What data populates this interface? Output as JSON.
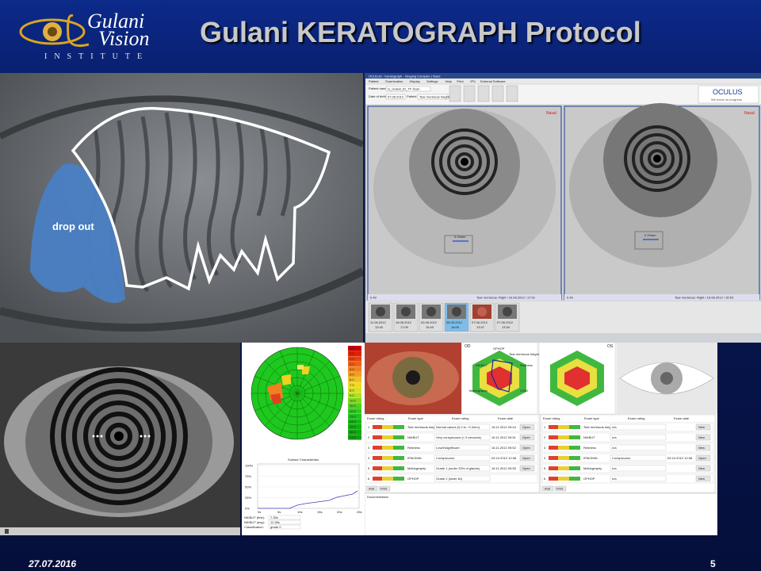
{
  "slide": {
    "title": "Gulani KERATOGRAPH Protocol",
    "date": "27.07.2016",
    "page_number": "5"
  },
  "logo": {
    "name_line1": "Gulani",
    "name_line2": "Vision",
    "institute": "INSTITUTE"
  },
  "tear_film": {
    "dropout_label": "drop out"
  },
  "app": {
    "title": "OCULUS - Keratograph - Imaging Compare | Tears",
    "menu": [
      "Patient",
      "Examination",
      "Display",
      "Settings",
      "Help",
      "Print",
      "IPX",
      "External Software"
    ],
    "patient_name_label": "Patient name:",
    "patient_name": "G_Gulani_ID_TF Scan",
    "dob_label": "Date of birth:",
    "dob": "07.08.2012",
    "patient_id_label": "Patient ID:",
    "patient_id": "Tear meniscus height",
    "brand": "OCULUS",
    "brand_tagline": "We focus on progress",
    "left_eye_label": "Nasal",
    "right_eye_label": "Nasal",
    "left_caption": "Tear meniscus: Right / 16.08.2012 / 17:01",
    "right_caption": "Tear meniscus: Right / 16.08.2012 / 16:53",
    "left_value": "0.49",
    "right_value": "0.49",
    "meniscus_left": "0.19mm",
    "meniscus_right": "0.19mm",
    "thumbnails": [
      {
        "date": "11.06.2012",
        "time": "13:40"
      },
      {
        "date": "16.06.2012",
        "time": "17:00"
      },
      {
        "date": "02.06.2012",
        "time": "15:40"
      },
      {
        "date": "08.05.2012",
        "time": "16:06"
      },
      {
        "date": "07.06.2012",
        "time": "13:37"
      },
      {
        "date": "07.06.2012",
        "time": "13:34"
      }
    ]
  },
  "heatmap": {
    "scale": [
      "0.0",
      "1.0",
      "2.0",
      "3.0",
      "4.0",
      "5.0",
      "6.0",
      "7.0",
      "8.0",
      "9.0",
      "10.0",
      "11.0",
      "12.0",
      "13.0",
      "14.0",
      "15.0",
      "16.0",
      "17.0"
    ]
  },
  "graph": {
    "title": "Surface Characteristic",
    "xlabels": [
      "0s",
      "5s",
      "10s",
      "15s",
      "20s",
      "25s"
    ],
    "ylabels": [
      "100%",
      "75%",
      "50%",
      "25%",
      "0%"
    ],
    "fields": [
      {
        "label": "NIKBUT (first):",
        "value": "7.39s"
      },
      {
        "label": "NIKBUT (avg):",
        "value": "11.38s"
      },
      {
        "label": "Classification:",
        "value": "grade 0"
      }
    ]
  },
  "report": {
    "od_label": "OD",
    "os_label": "OS",
    "radar_axes": [
      "OPHOP",
      "Tear meniscus height",
      "NIKBUT",
      "Redness",
      "Meibography",
      "OSDI"
    ],
    "table_headers": [
      "Exam rating",
      "Exam type",
      "Exam rating",
      "Exam date"
    ],
    "od_rows": [
      {
        "type": "Tear meniscus height",
        "rating": "Normal values (0.2 to ~0.3mm)",
        "date": "16.11.2012 09:44",
        "button": "Open"
      },
      {
        "type": "NIKBUT",
        "rating": "Very conspicuous (< 5 seconds)",
        "date": "16.11.2012 09:51",
        "button": "Open"
      },
      {
        "type": "Redness",
        "rating": "Low/Insignificant",
        "date": "16.11.2012 09:52",
        "button": "Open"
      },
      {
        "type": "IPM/JMIN",
        "rating": "Conspicuous",
        "date": "09.10.2012 10:38",
        "button": "Open"
      },
      {
        "type": "Meibography",
        "rating": "Grade 1 (under 33% of glands)",
        "date": "16.11.2012 09:55",
        "button": "Open"
      },
      {
        "type": "OPHOP",
        "rating": "Grade 2 (lower lid)",
        "date": "",
        "button": ""
      }
    ],
    "os_rows": [
      {
        "type": "Tear meniscus height",
        "rating": "n/a",
        "date": "",
        "button": "New"
      },
      {
        "type": "NIKBUT",
        "rating": "n/a",
        "date": "",
        "button": "New"
      },
      {
        "type": "Redness",
        "rating": "n/a",
        "date": "",
        "button": "New"
      },
      {
        "type": "IPM/JMIN",
        "rating": "Conspicuous",
        "date": "09.10.2012 10:38",
        "button": "Open"
      },
      {
        "type": "Meibography",
        "rating": "n/a",
        "date": "",
        "button": "New"
      },
      {
        "type": "OPHOP",
        "rating": "n/a",
        "date": "",
        "button": "New"
      }
    ],
    "documentation_label": "Documentation",
    "add_button": "Add",
    "print_button": "Print",
    "new_button": "New"
  }
}
